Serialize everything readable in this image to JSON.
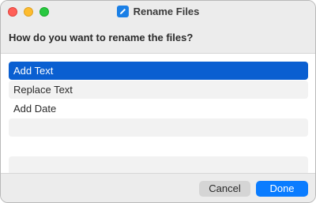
{
  "window": {
    "title": "Rename Files",
    "app_icon": "shortcuts-pencil-icon"
  },
  "prompt": "How do you want to rename the files?",
  "list": {
    "items": [
      "Add Text",
      "Replace Text",
      "Add Date",
      "",
      "",
      "",
      ""
    ],
    "selected_index": 0
  },
  "footer": {
    "cancel_label": "Cancel",
    "done_label": "Done"
  },
  "colors": {
    "selection": "#0a5fd1",
    "primary_button": "#0a7cff",
    "close": "#ff5f57",
    "minimize": "#febc2e",
    "zoom": "#28c840"
  }
}
